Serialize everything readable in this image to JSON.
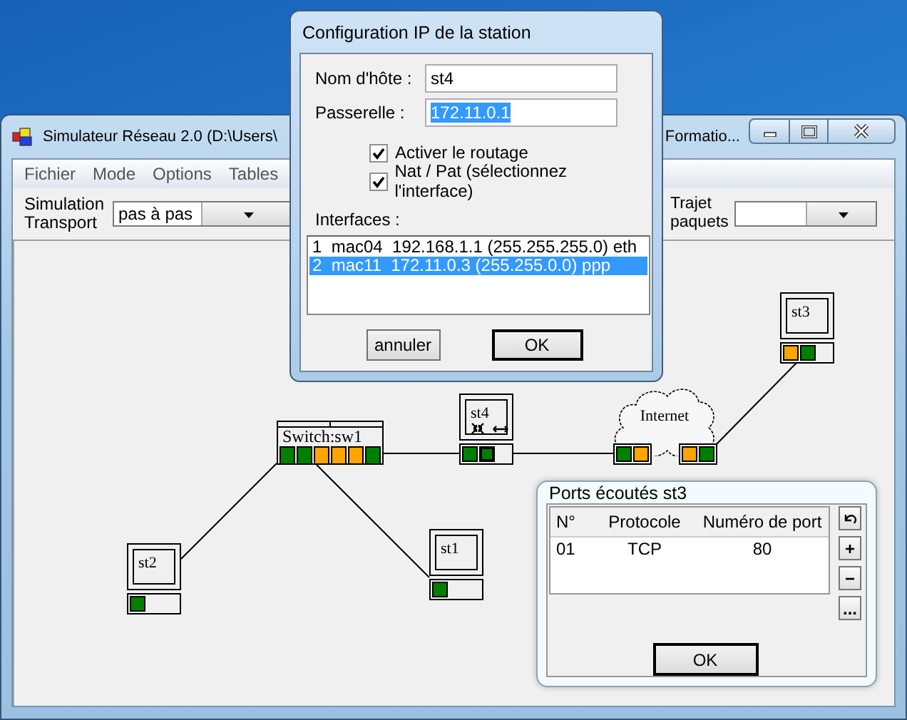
{
  "main_window": {
    "title_start": "Simulateur Réseau 2.0 (D:\\Users\\",
    "title_end": "Formatio...",
    "menu": [
      "Fichier",
      "Mode",
      "Options",
      "Tables"
    ],
    "toolbar": {
      "simulation_label": "Simulation Transport",
      "simulation_mode": "pas à pas",
      "trajet_label": "Trajet paquets"
    }
  },
  "network": {
    "nodes": [
      {
        "kind": "switch",
        "label": "Switch:sw1",
        "ports": [
          {
            "color": "#008000",
            "selected": false
          },
          {
            "color": "#008000",
            "selected": false
          },
          {
            "color": "#ffa500",
            "selected": false
          },
          {
            "color": "#ffa500",
            "selected": false
          },
          {
            "color": "#ffa500",
            "selected": false
          },
          {
            "color": "#008000",
            "selected": false
          }
        ]
      },
      {
        "kind": "station",
        "label": "st4",
        "router": true,
        "ports": [
          {
            "color": "#008000",
            "selected": false
          },
          {
            "color": "#008000",
            "selected": true
          }
        ]
      },
      {
        "kind": "cloud",
        "label": "Internet",
        "ports": [
          {
            "color": "#008000",
            "selected": false
          },
          {
            "color": "#ffa500",
            "selected": false
          },
          {
            "color": "#ffa500",
            "selected": false
          },
          {
            "color": "#008000",
            "selected": false
          }
        ]
      },
      {
        "kind": "station",
        "label": "st3",
        "router": false,
        "ports": [
          {
            "color": "#ffa500",
            "selected": false
          },
          {
            "color": "#008000",
            "selected": false
          }
        ]
      },
      {
        "kind": "station",
        "label": "st2",
        "router": false,
        "ports": [
          {
            "color": "#008000",
            "selected": false
          }
        ]
      },
      {
        "kind": "station",
        "label": "st1",
        "router": false,
        "ports": [
          {
            "color": "#008000",
            "selected": false
          }
        ]
      }
    ]
  },
  "ip_dialog": {
    "title": "Configuration IP de la station",
    "fields": [
      {
        "label": "Nom d'hôte :",
        "value": "st4",
        "highlighted": false
      },
      {
        "label": "Passerelle :",
        "value": "172.11.0.1",
        "highlighted": true
      }
    ],
    "checkboxes": [
      {
        "label": "Activer le routage",
        "checked": true
      },
      {
        "label": "Nat / Pat (sélectionnez l'interface)",
        "checked": true
      }
    ],
    "interfaces_label": "Interfaces :",
    "interfaces": [
      {
        "text": "1  mac04  192.168.1.1 (255.255.255.0) eth",
        "selected": false
      },
      {
        "text": "2  mac11  172.11.0.3 (255.255.0.0) ppp",
        "selected": true
      }
    ],
    "buttons": [
      {
        "label": "annuler",
        "default": false
      },
      {
        "label": "OK",
        "default": true
      }
    ]
  },
  "ports_dialog": {
    "title": "Ports écoutés st3",
    "table": {
      "columns": [
        "N°",
        "Protocole",
        "Numéro de port"
      ],
      "rows": [
        [
          "01",
          "TCP",
          "80"
        ]
      ]
    },
    "side_buttons": [
      "+",
      "−",
      "..."
    ],
    "ok_button": "OK"
  }
}
